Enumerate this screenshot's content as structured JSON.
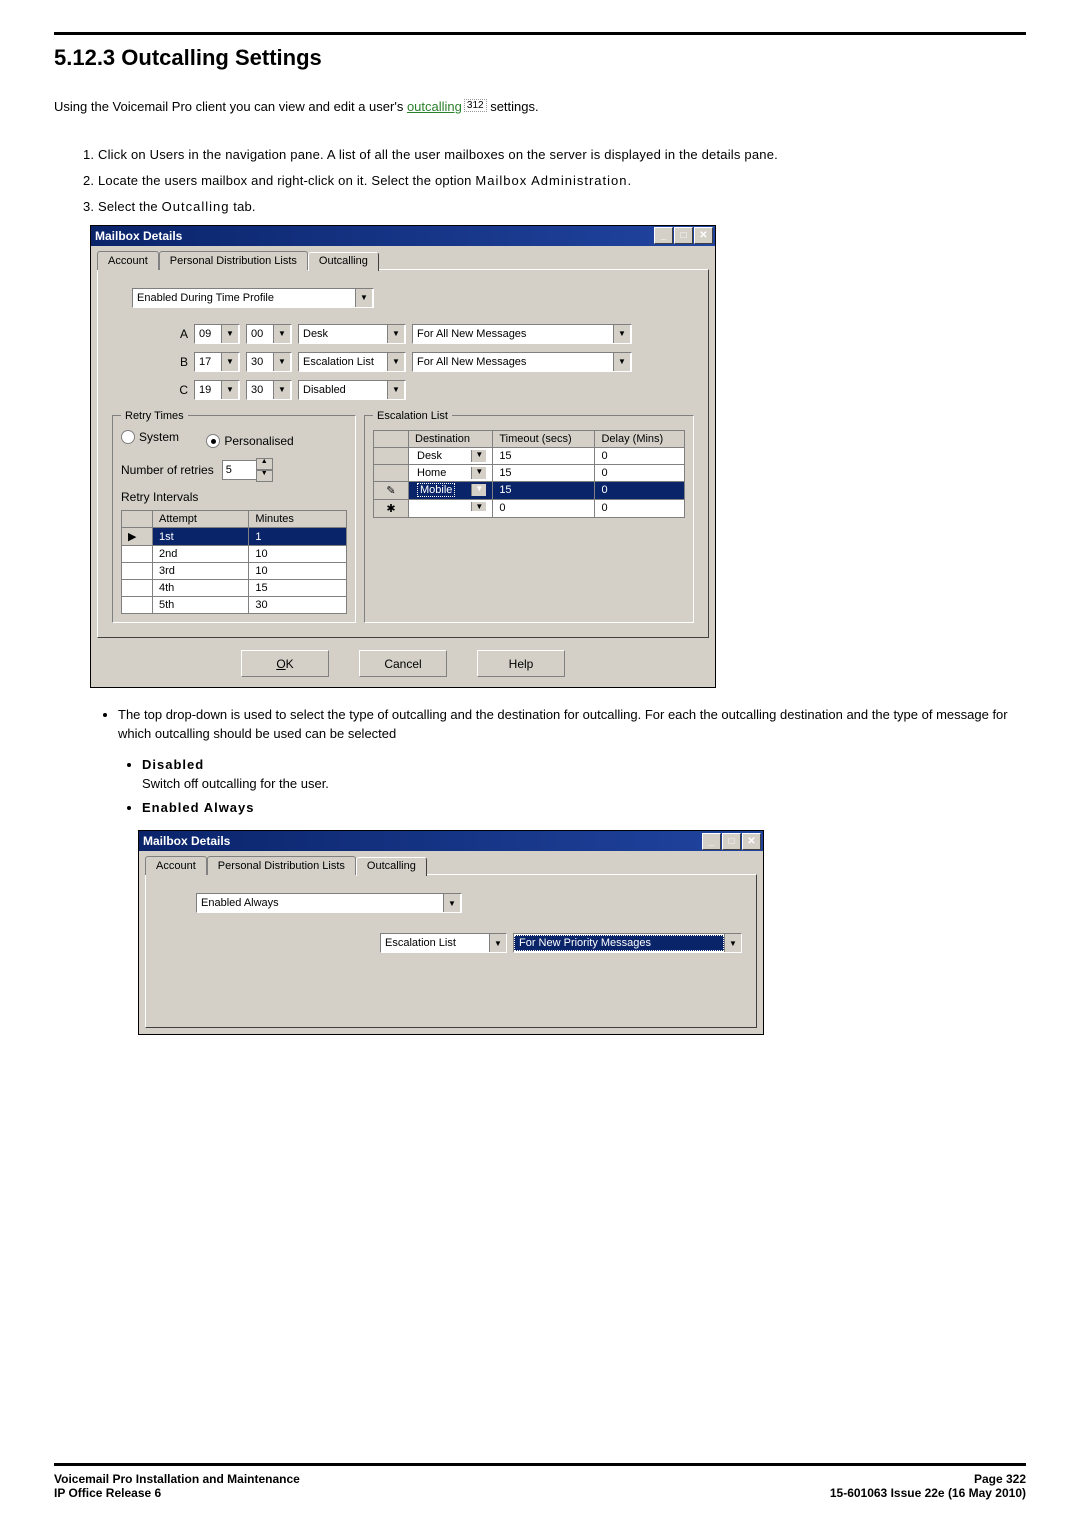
{
  "heading": "5.12.3 Outcalling Settings",
  "intro_pre": "Using the Voicemail Pro client you can view and edit a user's ",
  "intro_link": "outcalling",
  "intro_ref": "312",
  "intro_post": " settings.",
  "steps": [
    "Click on Users in the navigation pane. A list of all the user mailboxes on the server is displayed in the details pane.",
    "Locate the users mailbox and right-click on it. Select the option Mailbox Administration.",
    "Select the Outcalling tab."
  ],
  "dialog": {
    "title": "Mailbox Details",
    "tabs": [
      "Account",
      "Personal Distribution Lists",
      "Outcalling"
    ],
    "active_tab": 2,
    "mode": "Enabled During Time Profile",
    "rows": [
      {
        "lbl": "A",
        "h": "09",
        "m": "00",
        "dest": "Desk",
        "rule": "For All New Messages"
      },
      {
        "lbl": "B",
        "h": "17",
        "m": "30",
        "dest": "Escalation List",
        "rule": "For All New Messages"
      },
      {
        "lbl": "C",
        "h": "19",
        "m": "30",
        "dest": "Disabled",
        "rule": ""
      }
    ],
    "retry": {
      "group": "Retry Times",
      "system": "System",
      "personalised": "Personalised",
      "selected": "Personalised",
      "num_retries_label": "Number of retries",
      "num_retries": "5",
      "intervals_label": "Retry Intervals",
      "headers": [
        "Attempt",
        "Minutes"
      ],
      "rows": [
        {
          "a": "1st",
          "m": "1",
          "sel": true
        },
        {
          "a": "2nd",
          "m": "10"
        },
        {
          "a": "3rd",
          "m": "10"
        },
        {
          "a": "4th",
          "m": "15"
        },
        {
          "a": "5th",
          "m": "30"
        }
      ]
    },
    "escalation": {
      "group": "Escalation List",
      "headers": [
        "Destination",
        "Timeout (secs)",
        "Delay (Mins)"
      ],
      "rows": [
        {
          "dest": "Desk",
          "timeout": "15",
          "delay": "0"
        },
        {
          "dest": "Home",
          "timeout": "15",
          "delay": "0"
        },
        {
          "dest": "Mobile",
          "timeout": "15",
          "delay": "0",
          "sel": true,
          "marker": "pencil"
        },
        {
          "dest": "",
          "timeout": "0",
          "delay": "0",
          "marker": "star"
        }
      ]
    },
    "buttons": {
      "ok": "K",
      "ok_pre": "O",
      "cancel": "Cancel",
      "help": "Help"
    }
  },
  "after_bullets": {
    "top": "The top drop-down is used to select the type of outcalling and the destination for outcalling. For each the outcalling destination and the type of message for which outcalling should be used can be selected",
    "disabled_h": "Disabled",
    "disabled_b": "Switch off outcalling for the user.",
    "enabled_h": "Enabled Always"
  },
  "dialog2": {
    "title": "Mailbox Details",
    "tabs": [
      "Account",
      "Personal Distribution Lists",
      "Outcalling"
    ],
    "active_tab": 2,
    "mode": "Enabled Always",
    "dest": "Escalation List",
    "rule": "For New Priority Messages"
  },
  "footer": {
    "l1": "Voicemail Pro Installation and Maintenance",
    "l2": "IP Office Release 6",
    "r1": "Page 322",
    "r2": "15-601063 Issue 22e (16 May 2010)"
  }
}
